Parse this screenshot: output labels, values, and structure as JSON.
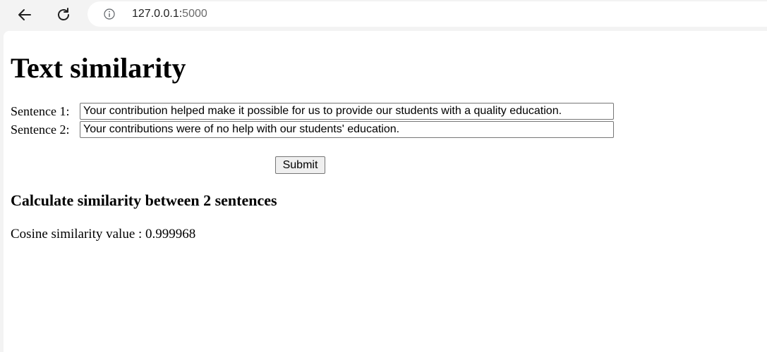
{
  "browser": {
    "url_host": "127.0.0.1:",
    "url_port": "5000"
  },
  "page": {
    "title": "Text similarity",
    "sentence1": {
      "label": "Sentence 1:",
      "value": "Your contribution helped make it possible for us to provide our students with a quality education."
    },
    "sentence2": {
      "label": "Sentence 2:",
      "value": "Your contributions were of no help with our students' education."
    },
    "submit_label": "Submit",
    "result_heading": "Calculate similarity between 2 sentences",
    "result_label": "Cosine similarity value : ",
    "result_value": "0.999968"
  },
  "icons": {
    "back": "back-arrow-icon",
    "reload": "reload-icon",
    "info": "info-icon"
  }
}
